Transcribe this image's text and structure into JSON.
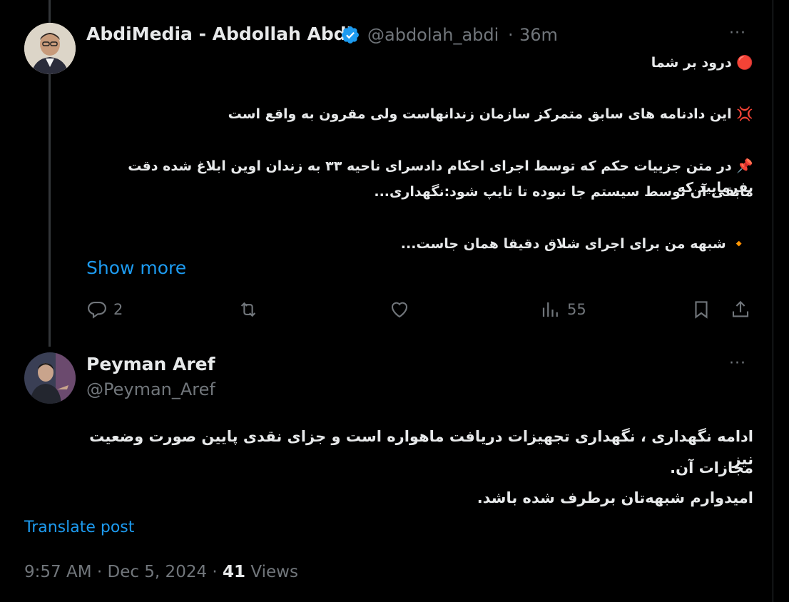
{
  "tweet1": {
    "display_name": "AbdiMedia - Abdollah Abdi",
    "handle": "@abdolah_abdi",
    "separator": "·",
    "time": "36m",
    "more": "···",
    "lines": [
      "درود بر شما",
      "این دادنامه های سابق متمرکز سازمان زندانهاست ولی مقرون به واقع است",
      "در متن جزییات حکم که توسط اجرای احکام دادسرای ناحیه ۳۳ به زندان اوین ابلاغ شده دقت بفرمایید که",
      "مابقی آن توسط سیستم جا نبوده تا تایپ شود:نگهداری...",
      "شبهه من برای اجرای شلاق دقیقا همان جاست..."
    ],
    "emojis": [
      "🔴",
      "💢",
      "📌",
      "🔸"
    ],
    "show_more": "Show more",
    "replies": "2",
    "views": "55"
  },
  "tweet2": {
    "display_name": "Peyman Aref",
    "handle": "@Peyman_Aref",
    "more": "···",
    "lines": [
      "ادامه نگهداری ، نگهداری تجهیزات دریافت ماهواره است و جزای نقدی پایین صورت وضعیت نیز",
      "مجازات آن.",
      "امیدوارم شبهه‌تان برطرف شده باشد."
    ],
    "translate": "Translate post",
    "time": "9:57 AM",
    "dot": "·",
    "date": "Dec 5, 2024",
    "views_count": "41",
    "views_label": "Views"
  },
  "colors": {
    "accent": "#1d9bf0",
    "muted": "#71767b",
    "text": "#e7e9ea",
    "background": "#000000"
  }
}
